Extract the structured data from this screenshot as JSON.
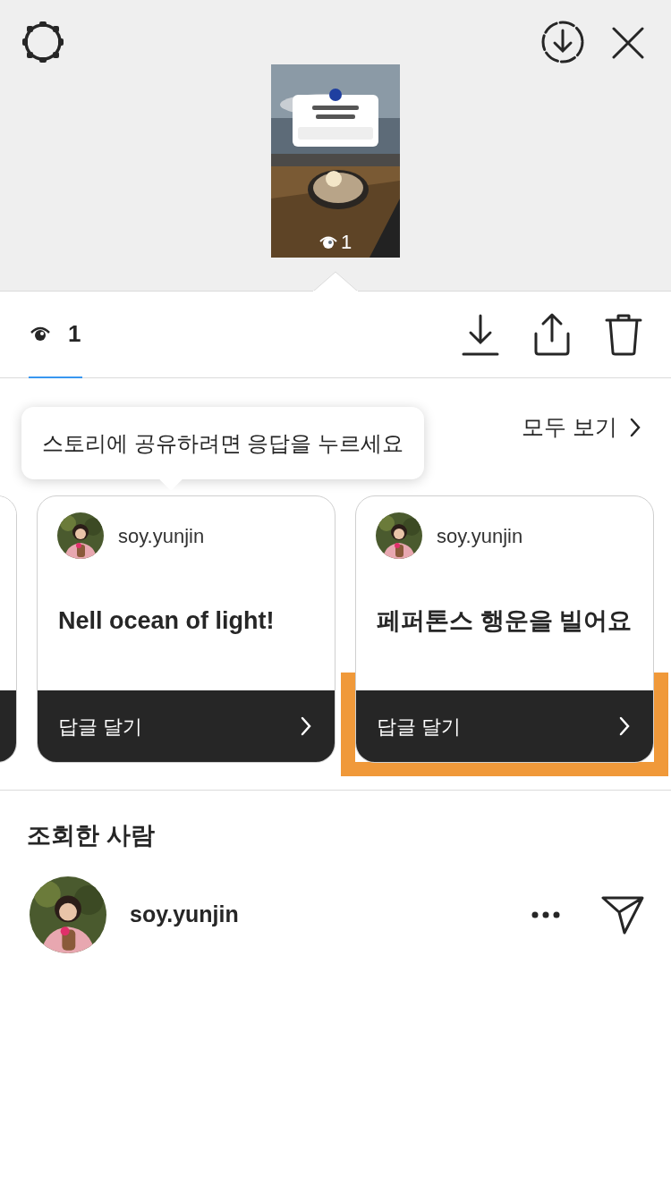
{
  "story_preview": {
    "kind": "picture",
    "view_count": "1"
  },
  "tabs": [
    {
      "label": "1",
      "selected": true
    }
  ],
  "responses": {
    "tooltip": "스토리에 공유하려면 응답을 누르세요",
    "see_all": "모두 보기",
    "cards": [
      {
        "username": "soy.yunjin",
        "text": "Nell ocean of light!",
        "button": "답글 달기",
        "highlighted": false
      },
      {
        "username": "soy.yunjin",
        "text": "페퍼톤스 행운을 빌어요",
        "button": "답글 달기",
        "highlighted": true
      }
    ]
  },
  "viewers": {
    "title": "조회한 사람",
    "items": [
      {
        "username": "soy.yunjin"
      }
    ]
  }
}
